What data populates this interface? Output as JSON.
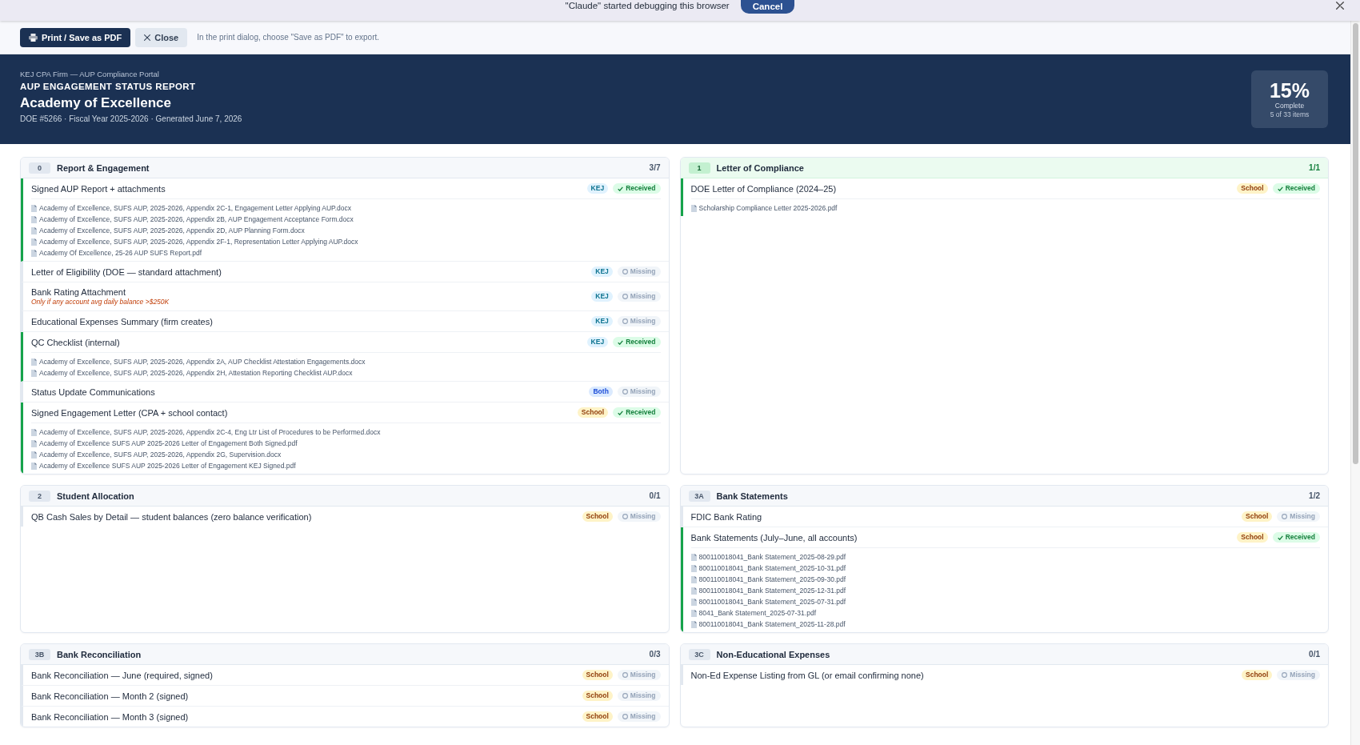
{
  "browser_infobar": {
    "message": "\"Claude\" started debugging this browser",
    "button": "Cancel"
  },
  "toolbar": {
    "buttons": [
      {
        "label": "Print / Save as PDF",
        "kind": "print"
      },
      {
        "label": "Close",
        "kind": "close"
      }
    ],
    "hint": "In the print dialog, choose \"Save as PDF\" to export."
  },
  "header": {
    "firm": "KEJ CPA Firm — AUP Compliance Portal",
    "report_title": "AUP ENGAGEMENT STATUS REPORT",
    "school": "Academy of Excellence",
    "meta": "DOE #5266 · Fiscal Year 2025-2026 · Generated June 7, 2026",
    "progress": {
      "percent": "15%",
      "label": "Complete",
      "detail": "5 of 33 items"
    }
  },
  "sections": [
    {
      "code": "0",
      "title": "Report & Engagement",
      "count": "3/7",
      "complete": false,
      "items": [
        {
          "title": "Signed AUP Report + attachments",
          "owner": {
            "label": "KEJ",
            "kind": "firm"
          },
          "status": "Received",
          "received": true,
          "files": [
            "Academy of Excellence, SUFS AUP, 2025-2026, Appendix 2C-1, Engagement Letter Applying AUP.docx",
            "Academy of Excellence, SUFS AUP, 2025-2026, Appendix 2B, AUP Engagement Acceptance Form.docx",
            "Academy of Excellence, SUFS AUP, 2025-2026, Appendix 2D, AUP Planning Form.docx",
            "Academy of Excellence, SUFS AUP, 2025-2026, Appendix 2F-1, Representation Letter Applying AUP.docx",
            "Academy Of Excellence, 25-26 AUP SUFS Report.pdf"
          ]
        },
        {
          "title": "Letter of Eligibility (DOE — standard attachment)",
          "owner": {
            "label": "KEJ",
            "kind": "firm"
          },
          "status": "Missing",
          "received": false
        },
        {
          "title": "Bank Rating Attachment",
          "note": "Only if any account avg daily balance >$250K",
          "owner": {
            "label": "KEJ",
            "kind": "firm"
          },
          "status": "Missing",
          "received": false
        },
        {
          "title": "Educational Expenses Summary (firm creates)",
          "owner": {
            "label": "KEJ",
            "kind": "firm"
          },
          "status": "Missing",
          "received": false
        },
        {
          "title": "QC Checklist (internal)",
          "owner": {
            "label": "KEJ",
            "kind": "firm"
          },
          "status": "Received",
          "received": true,
          "files": [
            "Academy of Excellence, SUFS AUP, 2025-2026, Appendix 2A, AUP Checklist Attestation Engagements.docx",
            "Academy of Excellence, SUFS AUP, 2025-2026, Appendix 2H, Attestation Reporting Checklist AUP.docx"
          ]
        },
        {
          "title": "Status Update Communications",
          "owner": {
            "label": "Both",
            "kind": "both"
          },
          "status": "Missing",
          "received": false
        },
        {
          "title": "Signed Engagement Letter (CPA + school contact)",
          "owner": {
            "label": "School",
            "kind": "school"
          },
          "status": "Received",
          "received": true,
          "files": [
            "Academy of Excellence, SUFS AUP, 2025-2026, Appendix 2C-4, Eng Ltr List of Procedures to be Performed.docx",
            "Academy of Excellence SUFS AUP 2025-2026 Letter of Engagement Both Signed.pdf",
            "Academy of Excellence, SUFS AUP, 2025-2026, Appendix 2G, Supervision.docx",
            "Academy of Excellence SUFS AUP 2025-2026 Letter of Engagement KEJ Signed.pdf"
          ]
        }
      ]
    },
    {
      "code": "1",
      "title": "Letter of Compliance",
      "count": "1/1",
      "complete": true,
      "items": [
        {
          "title": "DOE Letter of Compliance (2024–25)",
          "owner": {
            "label": "School",
            "kind": "school"
          },
          "status": "Received",
          "received": true,
          "files": [
            "Scholarship Compliance Letter 2025-2026.pdf"
          ]
        }
      ]
    },
    {
      "code": "2",
      "title": "Student Allocation",
      "count": "0/1",
      "complete": false,
      "items": [
        {
          "title": "QB Cash Sales by Detail — student balances (zero balance verification)",
          "owner": {
            "label": "School",
            "kind": "school"
          },
          "status": "Missing",
          "received": false
        }
      ]
    },
    {
      "code": "3A",
      "title": "Bank Statements",
      "count": "1/2",
      "complete": false,
      "items": [
        {
          "title": "FDIC Bank Rating",
          "owner": {
            "label": "School",
            "kind": "school"
          },
          "status": "Missing",
          "received": false
        },
        {
          "title": "Bank Statements (July–June, all accounts)",
          "owner": {
            "label": "School",
            "kind": "school"
          },
          "status": "Received",
          "received": true,
          "files": [
            "800110018041_Bank Statement_2025-08-29.pdf",
            "800110018041_Bank Statement_2025-10-31.pdf",
            "800110018041_Bank Statement_2025-09-30.pdf",
            "800110018041_Bank Statement_2025-12-31.pdf",
            "800110018041_Bank Statement_2025-07-31.pdf",
            "8041_Bank Statement_2025-07-31.pdf",
            "800110018041_Bank Statement_2025-11-28.pdf"
          ]
        }
      ]
    },
    {
      "code": "3B",
      "title": "Bank Reconciliation",
      "count": "0/3",
      "complete": false,
      "items": [
        {
          "title": "Bank Reconciliation — June (required, signed)",
          "owner": {
            "label": "School",
            "kind": "school"
          },
          "status": "Missing",
          "received": false
        },
        {
          "title": "Bank Reconciliation — Month 2 (signed)",
          "owner": {
            "label": "School",
            "kind": "school"
          },
          "status": "Missing",
          "received": false
        },
        {
          "title": "Bank Reconciliation — Month 3 (signed)",
          "owner": {
            "label": "School",
            "kind": "school"
          },
          "status": "Missing",
          "received": false
        }
      ]
    },
    {
      "code": "3C",
      "title": "Non-Educational Expenses",
      "count": "0/1",
      "complete": false,
      "items": [
        {
          "title": "Non-Ed Expense Listing from GL (or email confirming none)",
          "owner": {
            "label": "School",
            "kind": "school"
          },
          "status": "Missing",
          "received": false
        }
      ]
    }
  ]
}
